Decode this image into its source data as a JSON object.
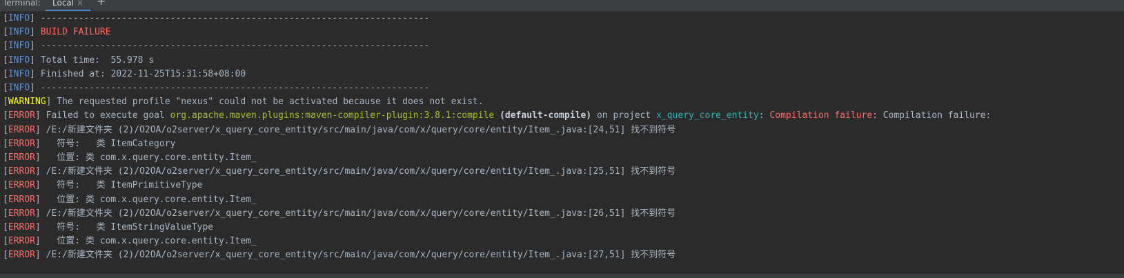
{
  "tabbar": {
    "label": "Terminal:",
    "tab": "Local",
    "close_glyph": "×",
    "add_glyph": "+"
  },
  "lines": [
    {
      "level": "INFO",
      "segments": [
        {
          "text": " ------------------------------------------------------------------------",
          "cls": ""
        }
      ]
    },
    {
      "level": "INFO",
      "segments": [
        {
          "text": " ",
          "cls": ""
        },
        {
          "text": "BUILD FAILURE",
          "cls": "c-red"
        }
      ]
    },
    {
      "level": "INFO",
      "segments": [
        {
          "text": " ------------------------------------------------------------------------",
          "cls": ""
        }
      ]
    },
    {
      "level": "INFO",
      "segments": [
        {
          "text": " Total time:  55.978 s",
          "cls": ""
        }
      ]
    },
    {
      "level": "INFO",
      "segments": [
        {
          "text": " Finished at: 2022-11-25T15:31:58+08:00",
          "cls": ""
        }
      ]
    },
    {
      "level": "INFO",
      "segments": [
        {
          "text": " ------------------------------------------------------------------------",
          "cls": ""
        }
      ]
    },
    {
      "level": "WARNING",
      "segments": [
        {
          "text": " The requested profile \"nexus\" could not be activated because it does not exist.",
          "cls": ""
        }
      ]
    },
    {
      "level": "ERROR",
      "segments": [
        {
          "text": " Failed to execute goal ",
          "cls": ""
        },
        {
          "text": "org.apache.maven.plugins:maven-compiler-plugin:3.8.1:compile",
          "cls": "c-green"
        },
        {
          "text": " ",
          "cls": ""
        },
        {
          "text": "(default-compile)",
          "cls": "c-bold"
        },
        {
          "text": " on project ",
          "cls": ""
        },
        {
          "text": "x_query_core_entity",
          "cls": "c-cyan"
        },
        {
          "text": ": ",
          "cls": ""
        },
        {
          "text": "Compilation failure",
          "cls": "c-red"
        },
        {
          "text": ": Compilation failure:",
          "cls": ""
        }
      ]
    },
    {
      "level": "ERROR",
      "segments": [
        {
          "text": " /E:/新建文件夹 (2)/O2OA/o2server/x_query_core_entity/src/main/java/com/x/query/core/entity/Item_.java:[24,51] 找不到符号",
          "cls": ""
        }
      ]
    },
    {
      "level": "ERROR",
      "segments": [
        {
          "text": "   符号:   类 ItemCategory",
          "cls": ""
        }
      ]
    },
    {
      "level": "ERROR",
      "segments": [
        {
          "text": "   位置: 类 com.x.query.core.entity.Item_",
          "cls": ""
        }
      ]
    },
    {
      "level": "ERROR",
      "segments": [
        {
          "text": " /E:/新建文件夹 (2)/O2OA/o2server/x_query_core_entity/src/main/java/com/x/query/core/entity/Item_.java:[25,51] 找不到符号",
          "cls": ""
        }
      ]
    },
    {
      "level": "ERROR",
      "segments": [
        {
          "text": "   符号:   类 ItemPrimitiveType",
          "cls": ""
        }
      ]
    },
    {
      "level": "ERROR",
      "segments": [
        {
          "text": "   位置: 类 com.x.query.core.entity.Item_",
          "cls": ""
        }
      ]
    },
    {
      "level": "ERROR",
      "segments": [
        {
          "text": " /E:/新建文件夹 (2)/O2OA/o2server/x_query_core_entity/src/main/java/com/x/query/core/entity/Item_.java:[26,51] 找不到符号",
          "cls": ""
        }
      ]
    },
    {
      "level": "ERROR",
      "segments": [
        {
          "text": "   符号:   类 ItemStringValueType",
          "cls": ""
        }
      ]
    },
    {
      "level": "ERROR",
      "segments": [
        {
          "text": "   位置: 类 com.x.query.core.entity.Item_",
          "cls": ""
        }
      ]
    },
    {
      "level": "ERROR",
      "segments": [
        {
          "text": " /E:/新建文件夹 (2)/O2OA/o2server/x_query_core_entity/src/main/java/com/x/query/core/entity/Item_.java:[27,51] 找不到符号",
          "cls": ""
        }
      ]
    }
  ],
  "colors": {
    "background": "#2b2b2b",
    "info": "#5394ec",
    "warning": "#ffff00",
    "error": "#ff6b68",
    "plugin": "#a8c023",
    "project": "#2fb5b0"
  }
}
